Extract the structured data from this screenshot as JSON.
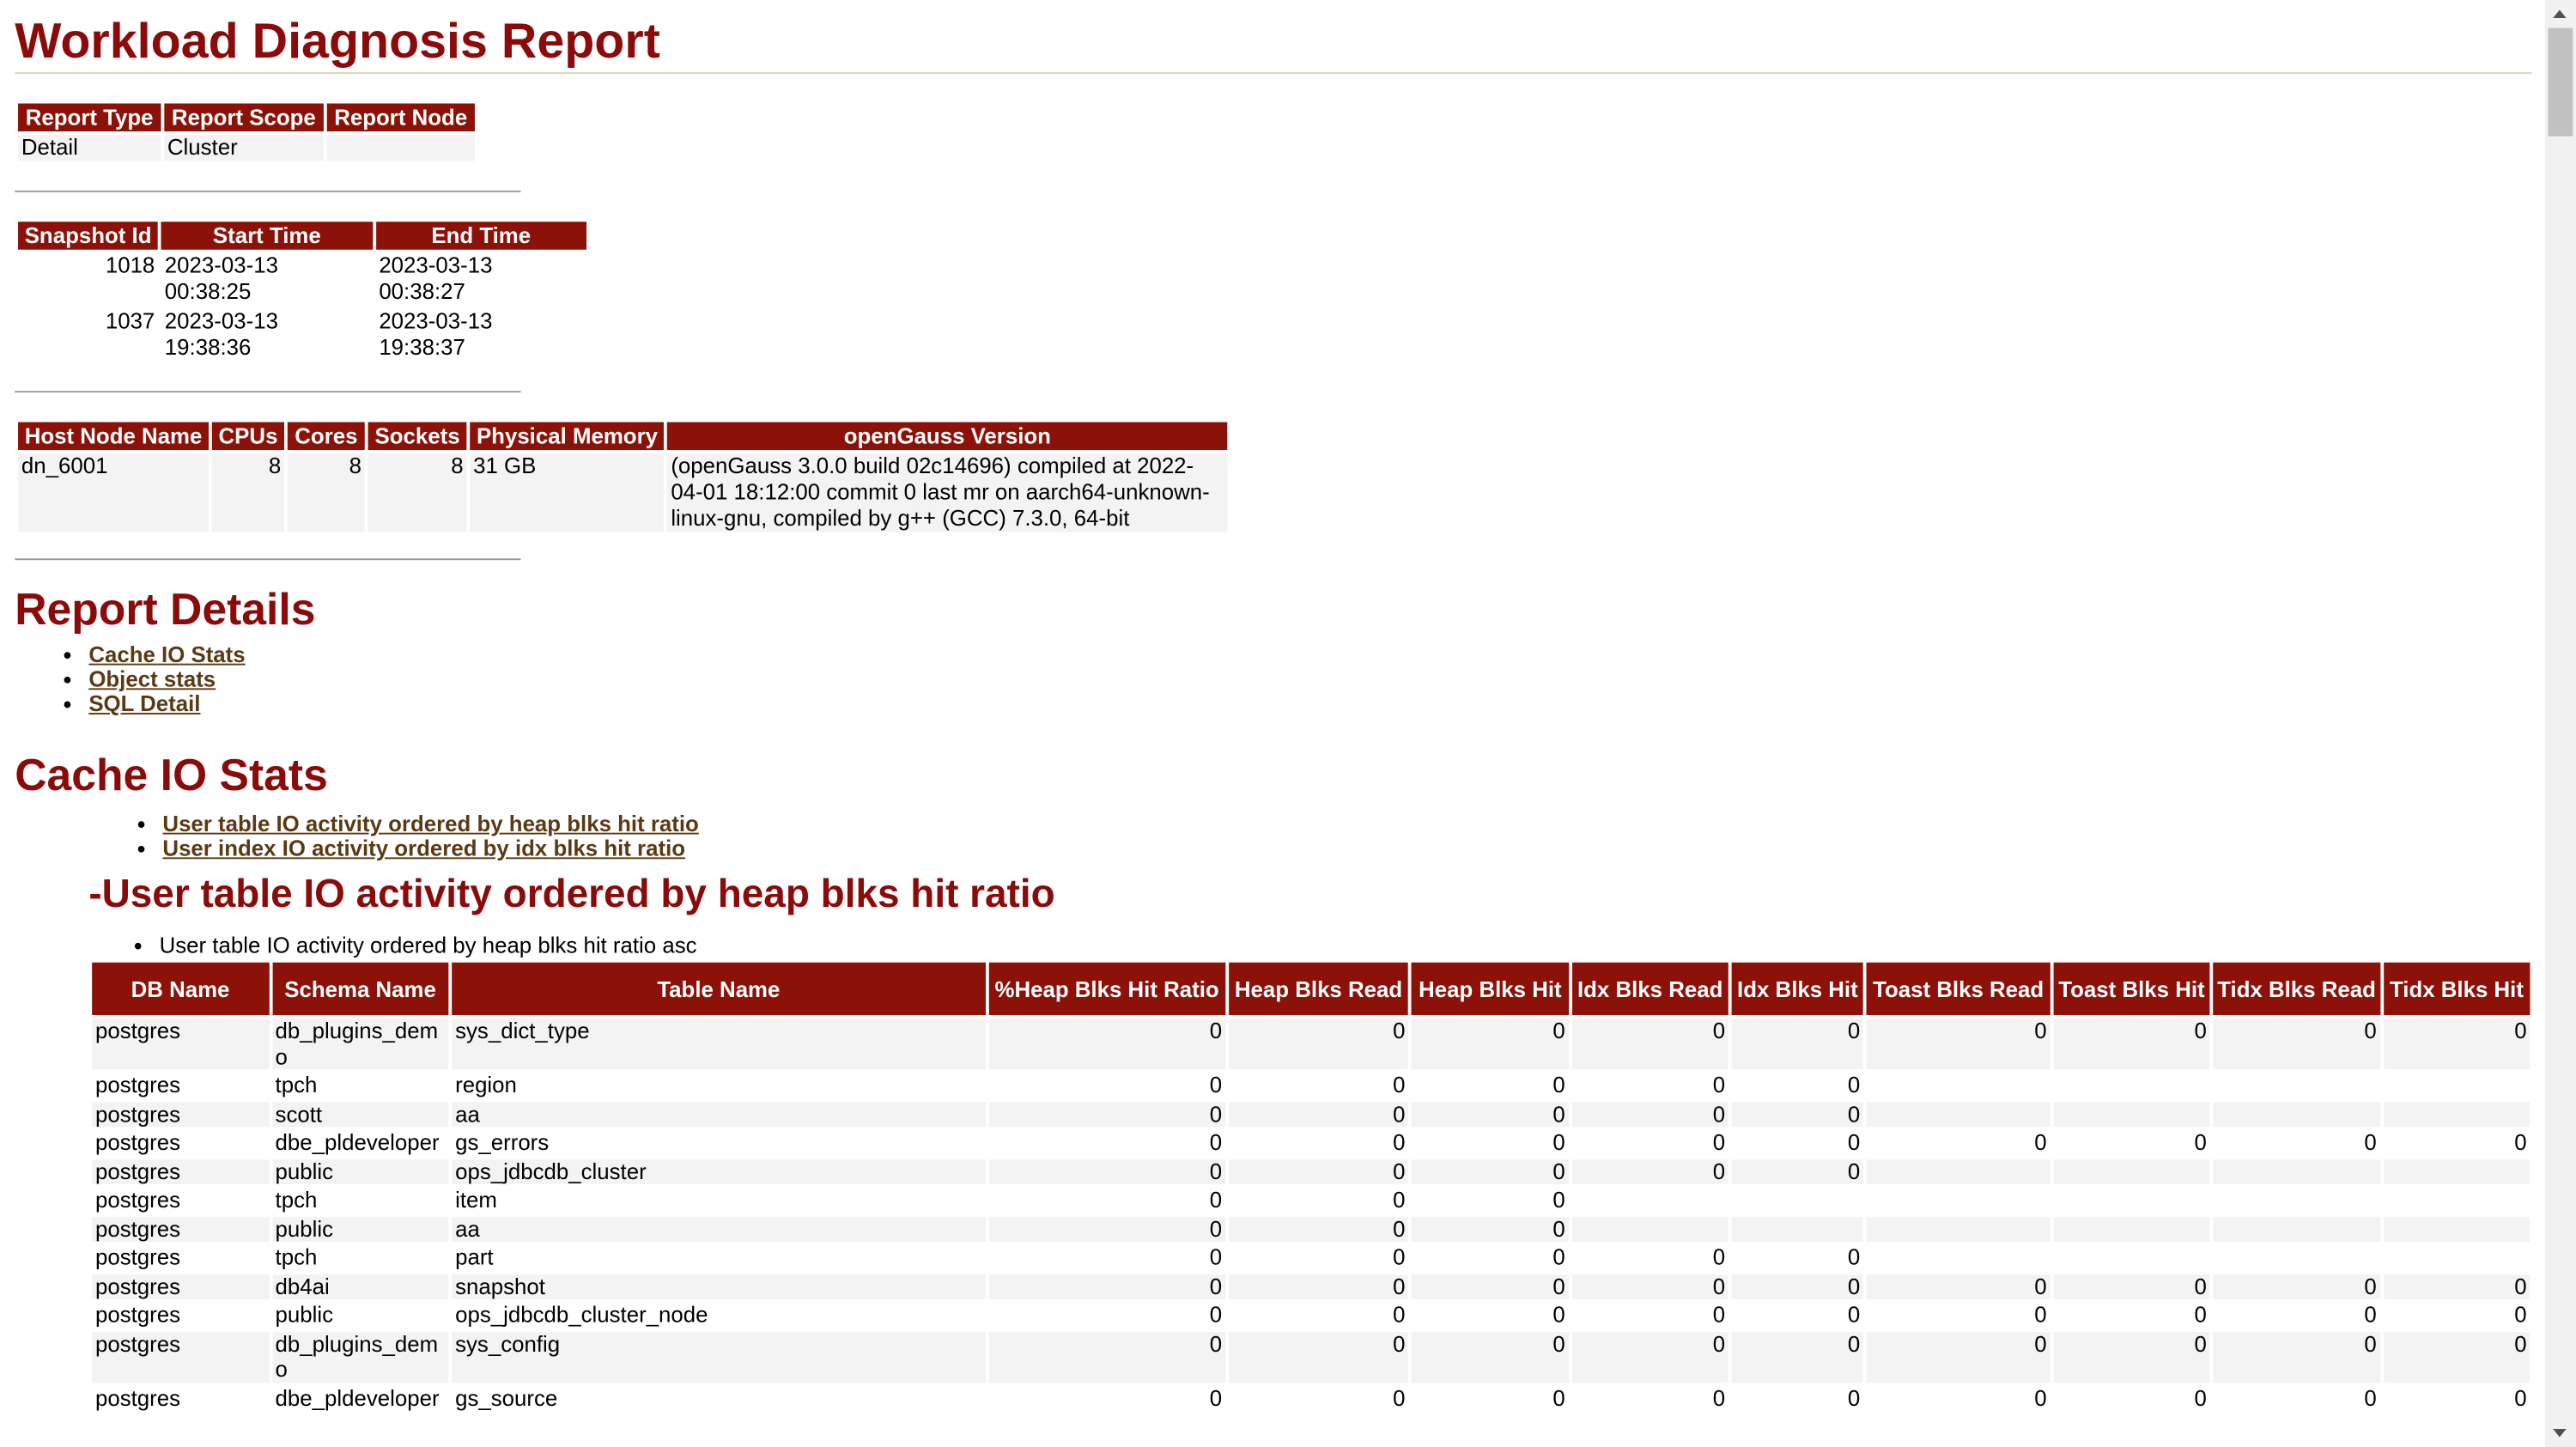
{
  "title": "Workload Diagnosis Report",
  "report_info": {
    "headers": [
      "Report Type",
      "Report Scope",
      "Report Node"
    ],
    "row": [
      "Detail",
      "Cluster",
      ""
    ]
  },
  "snapshots": {
    "headers": [
      "Snapshot Id",
      "Start Time",
      "End Time"
    ],
    "rows": [
      [
        "1018",
        "2023-03-13 00:38:25",
        "2023-03-13 00:38:27"
      ],
      [
        "1037",
        "2023-03-13 19:38:36",
        "2023-03-13 19:38:37"
      ]
    ]
  },
  "host": {
    "headers": [
      "Host Node Name",
      "CPUs",
      "Cores",
      "Sockets",
      "Physical Memory",
      "openGauss Version"
    ],
    "row": [
      "dn_6001",
      "8",
      "8",
      "8",
      "31 GB",
      "(openGauss 3.0.0 build 02c14696) compiled at 2022-04-01 18:12:00 commit 0 last mr on aarch64-unknown-linux-gnu, compiled by g++ (GCC) 7.3.0, 64-bit"
    ]
  },
  "report_details": {
    "heading": "Report Details",
    "links": [
      "Cache IO Stats",
      "Object stats",
      "SQL Detail"
    ]
  },
  "cache_io": {
    "heading": "Cache IO Stats",
    "links": [
      "User table IO activity ordered by heap blks hit ratio",
      "User index IO activity ordered by idx blks hit ratio"
    ],
    "subheading": "-User table IO activity ordered by heap blks hit ratio",
    "note": "User table IO activity ordered by heap blks hit ratio asc",
    "headers": [
      "DB Name",
      "Schema Name",
      "Table Name",
      "%Heap Blks Hit Ratio",
      "Heap Blks Read",
      "Heap Blks Hit",
      "Idx Blks Read",
      "Idx Blks Hit",
      "Toast Blks Read",
      "Toast Blks Hit",
      "Tidx Blks Read",
      "Tidx Blks Hit"
    ],
    "rows": [
      [
        "postgres",
        "db_plugins_demo",
        "sys_dict_type",
        "0",
        "0",
        "0",
        "0",
        "0",
        "0",
        "0",
        "0",
        "0"
      ],
      [
        "postgres",
        "tpch",
        "region",
        "0",
        "0",
        "0",
        "0",
        "0",
        "",
        "",
        "",
        ""
      ],
      [
        "postgres",
        "scott",
        "aa",
        "0",
        "0",
        "0",
        "0",
        "0",
        "",
        "",
        "",
        ""
      ],
      [
        "postgres",
        "dbe_pldeveloper",
        "gs_errors",
        "0",
        "0",
        "0",
        "0",
        "0",
        "0",
        "0",
        "0",
        "0"
      ],
      [
        "postgres",
        "public",
        "ops_jdbcdb_cluster",
        "0",
        "0",
        "0",
        "0",
        "0",
        "",
        "",
        "",
        ""
      ],
      [
        "postgres",
        "tpch",
        "item",
        "0",
        "0",
        "0",
        "",
        "",
        "",
        "",
        "",
        ""
      ],
      [
        "postgres",
        "public",
        "aa",
        "0",
        "0",
        "0",
        "",
        "",
        "",
        "",
        "",
        ""
      ],
      [
        "postgres",
        "tpch",
        "part",
        "0",
        "0",
        "0",
        "0",
        "0",
        "",
        "",
        "",
        ""
      ],
      [
        "postgres",
        "db4ai",
        "snapshot",
        "0",
        "0",
        "0",
        "0",
        "0",
        "0",
        "0",
        "0",
        "0"
      ],
      [
        "postgres",
        "public",
        "ops_jdbcdb_cluster_node",
        "0",
        "0",
        "0",
        "0",
        "0",
        "0",
        "0",
        "0",
        "0"
      ],
      [
        "postgres",
        "db_plugins_demo",
        "sys_config",
        "0",
        "0",
        "0",
        "0",
        "0",
        "0",
        "0",
        "0",
        "0"
      ],
      [
        "postgres",
        "dbe_pldeveloper",
        "gs_source",
        "0",
        "0",
        "0",
        "0",
        "0",
        "0",
        "0",
        "0",
        "0"
      ]
    ]
  }
}
